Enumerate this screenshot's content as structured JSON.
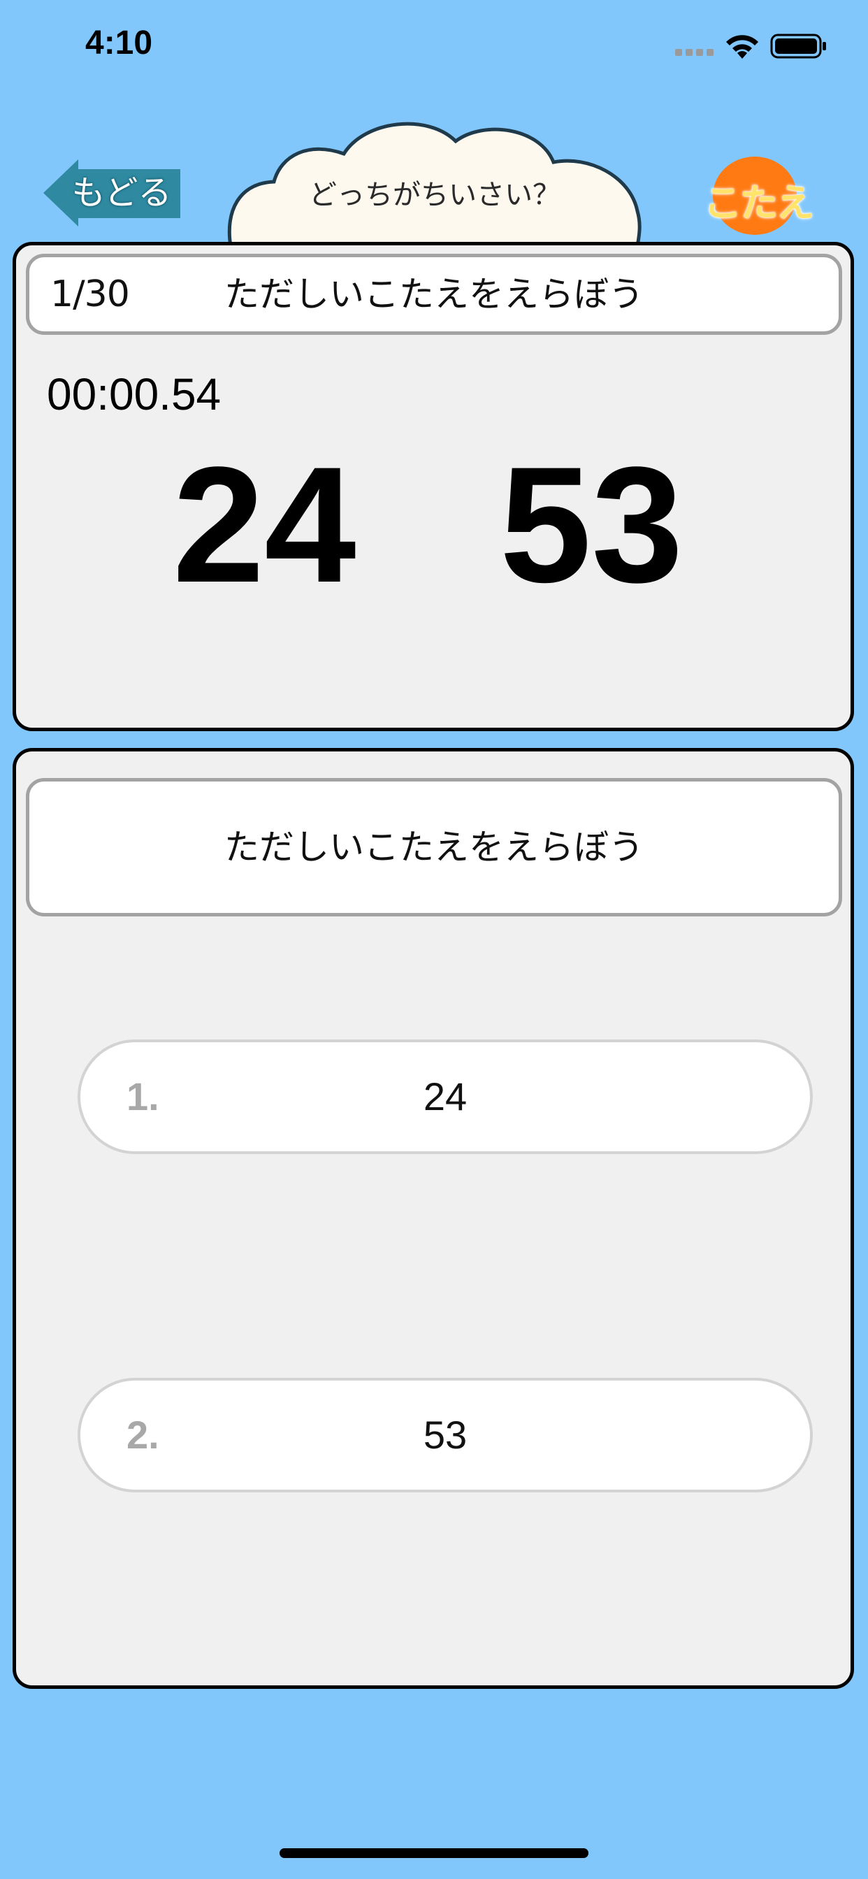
{
  "status_bar": {
    "time": "4:10",
    "signal_icon": "cellular-signal-icon",
    "wifi_icon": "wifi-icon",
    "battery_icon": "battery-icon"
  },
  "header": {
    "back_label": "もどる",
    "title": "どっちがちいさい？",
    "answer_label": "こたえ"
  },
  "question": {
    "progress": "1/30",
    "instruction": "ただしいこたえをえらぼう",
    "timer": "00:00.54",
    "numbers": [
      "24",
      "53"
    ]
  },
  "answer": {
    "instruction": "ただしいこたえをえらぼう",
    "choices": [
      {
        "index": "1.",
        "value": "24"
      },
      {
        "index": "2.",
        "value": "53"
      }
    ]
  },
  "colors": {
    "background": "#82c7fc",
    "panel": "#f0f0f0",
    "back_button": "#2f8aa1",
    "answer_button": "#ff7a12",
    "cloud_fill": "#fdf9ef"
  }
}
